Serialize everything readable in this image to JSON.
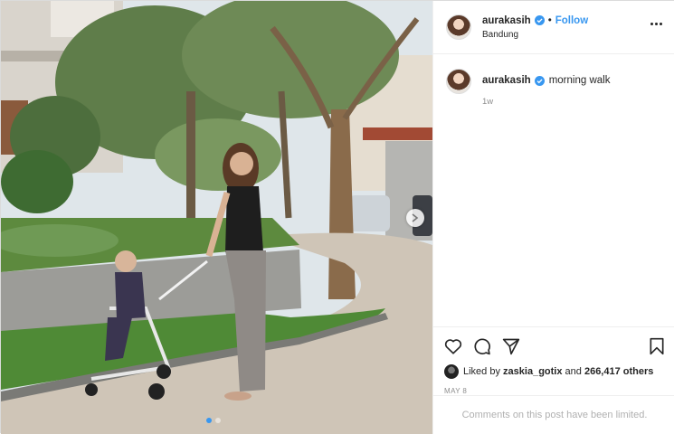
{
  "post": {
    "username": "aurakasih",
    "separator": "•",
    "follow_label": "Follow",
    "location": "Bandung",
    "caption_username": "aurakasih",
    "caption_text": "morning walk",
    "time_ago": "1w",
    "likes_prefix": "Liked by",
    "liked_by_user": "zaskia_gotix",
    "likes_conjunction": "and",
    "likes_count": "266,417 others",
    "date": "MAY 8",
    "comments_status": "Comments on this post have been limited."
  },
  "carousel": {
    "slides": 2,
    "active_index": 0
  },
  "icons": {
    "verified": "verified-badge-icon",
    "more": "more-options-icon",
    "like": "heart-icon",
    "comment": "comment-icon",
    "share": "share-icon",
    "save": "bookmark-icon",
    "next": "chevron-right-icon"
  },
  "colors": {
    "accent": "#3897f0",
    "text": "#262626",
    "muted": "#8e8e8e"
  }
}
